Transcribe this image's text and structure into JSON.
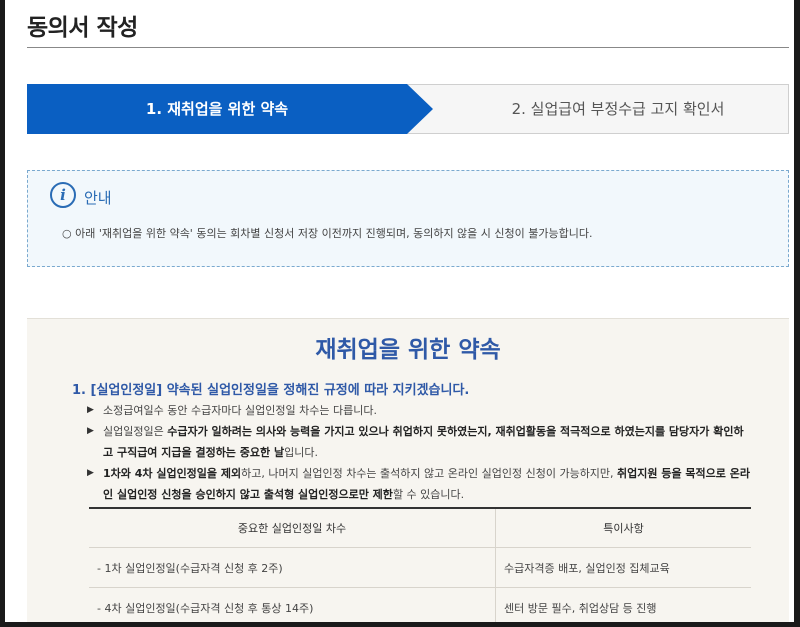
{
  "page": {
    "title": "동의서 작성"
  },
  "steps": [
    {
      "label": "1. 재취업을 위한 약속",
      "active": true
    },
    {
      "label": "2. 실업급여 부정수급 고지 확인서",
      "active": false
    }
  ],
  "notice": {
    "icon": "info-icon",
    "title": "안내",
    "text": "○ 아래 '재취업을 위한 약속' 동의는 회차별 신청서 저장 이전까지 진행되며, 동의하지 않을 시 신청이 불가능합니다."
  },
  "promise": {
    "title": "재취업을 위한 약속",
    "section1": {
      "heading": "1. [실업인정일] 약속된 실업인정일을 정해진 규정에 따라 지키겠습니다.",
      "bullets": [
        {
          "segments": [
            {
              "t": "소정급여일수 동안 수급자마다 실업인정일 차수는 다릅니다.",
              "b": false
            }
          ]
        },
        {
          "segments": [
            {
              "t": "실업일정일은 ",
              "b": false
            },
            {
              "t": "수급자가 일하려는 의사와 능력을 가지고 있으나 취업하지 못하였는지, 재취업활동을 적극적으로 하였는지를 담당자가 확인하고 구직급여 지급을 결정하는 중요한 날",
              "b": true
            },
            {
              "t": "입니다.",
              "b": false
            }
          ]
        },
        {
          "segments": [
            {
              "t": "1차와 4차 실업인정일을 제외",
              "b": true
            },
            {
              "t": "하고, 나머지 실업인정 차수는 출석하지 않고 온라인 실업인정 신청이 가능하지만, ",
              "b": false
            },
            {
              "t": "취업지원 등을 목적으로 온라인 실업인정 신청을 승인하지 않고 출석형 실업인정으로만 제한",
              "b": true
            },
            {
              "t": "할 수 있습니다.",
              "b": false
            }
          ]
        }
      ],
      "table": {
        "headers": [
          "중요한 실업인정일 차수",
          "특이사항"
        ],
        "rows": [
          [
            "- 1차 실업인정일(수급자격 신청 후 2주)",
            "수급자격증 배포, 실업인정 집체교육"
          ],
          [
            "- 4차 실업인정일(수급자격 신청 후 통상 14주)",
            "센터 방문 필수, 취업상담 등 진행"
          ]
        ]
      }
    }
  }
}
